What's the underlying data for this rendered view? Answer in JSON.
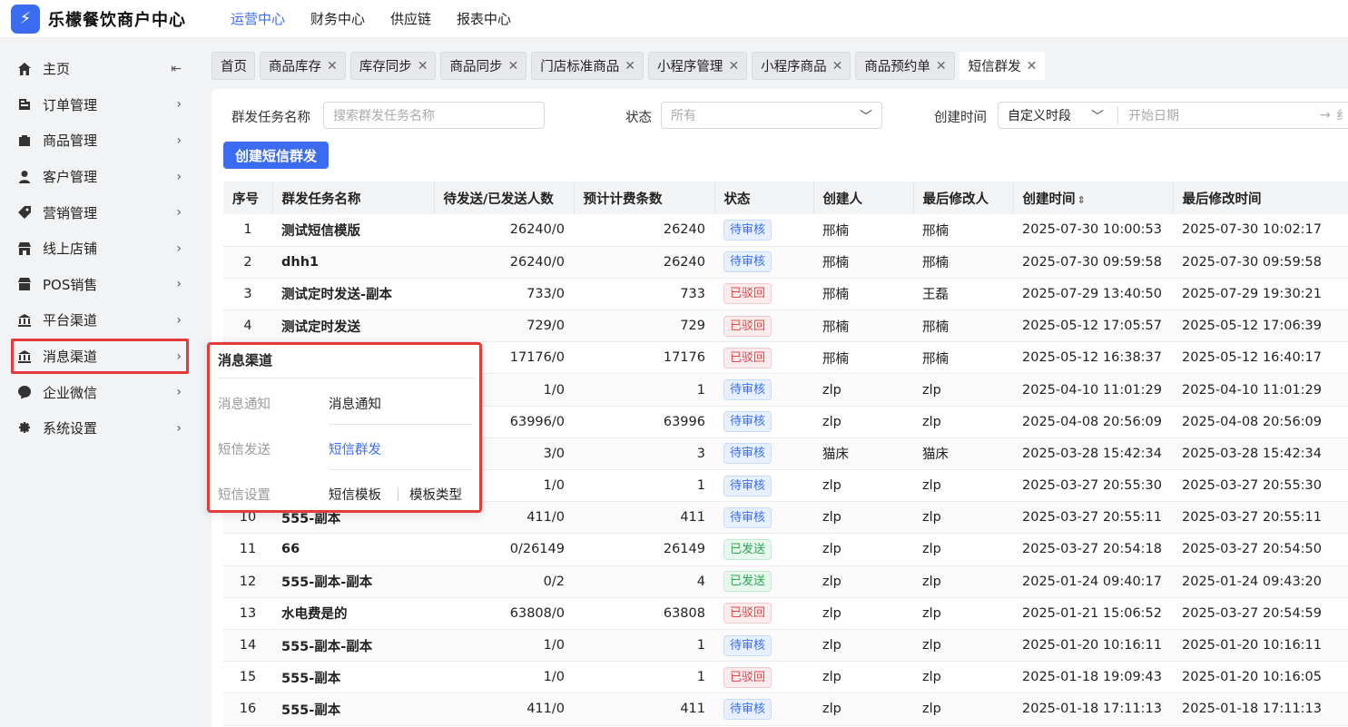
{
  "app": {
    "title": "乐檬餐饮商户中心",
    "logo_glyph": "⚡"
  },
  "top_nav": [
    {
      "label": "运营中心",
      "active": true
    },
    {
      "label": "财务中心",
      "active": false
    },
    {
      "label": "供应链",
      "active": false
    },
    {
      "label": "报表中心",
      "active": false
    }
  ],
  "sidebar": {
    "collapse_glyph": "⇤",
    "arrow_glyph": "›",
    "items": [
      {
        "label": "主页",
        "icon": "home-icon"
      },
      {
        "label": "订单管理",
        "icon": "order-icon"
      },
      {
        "label": "商品管理",
        "icon": "goods-icon"
      },
      {
        "label": "客户管理",
        "icon": "user-icon"
      },
      {
        "label": "营销管理",
        "icon": "tag-icon"
      },
      {
        "label": "线上店铺",
        "icon": "store-icon"
      },
      {
        "label": "POS销售",
        "icon": "pos-icon"
      },
      {
        "label": "平台渠道",
        "icon": "platform-icon"
      },
      {
        "label": "消息渠道",
        "icon": "message-icon"
      },
      {
        "label": "企业微信",
        "icon": "wechat-icon"
      },
      {
        "label": "系统设置",
        "icon": "gear-icon"
      }
    ]
  },
  "tabs": [
    {
      "label": "首页",
      "closable": false
    },
    {
      "label": "商品库存",
      "closable": true
    },
    {
      "label": "库存同步",
      "closable": true
    },
    {
      "label": "商品同步",
      "closable": true
    },
    {
      "label": "门店标准商品",
      "closable": true
    },
    {
      "label": "小程序管理",
      "closable": true
    },
    {
      "label": "小程序商品",
      "closable": true
    },
    {
      "label": "商品预约单",
      "closable": true
    },
    {
      "label": "短信群发",
      "closable": true,
      "active": true
    }
  ],
  "tab_close_glyph": "✕",
  "filters": {
    "task_name_label": "群发任务名称",
    "task_name_placeholder": "搜索群发任务名称",
    "status_label": "状态",
    "status_value": "所有",
    "created_label": "创建时间",
    "created_range_value": "自定义时段",
    "start_date_placeholder": "开始日期",
    "range_sep": "→",
    "end_partial": "纟"
  },
  "create_button": "创建短信群发",
  "table": {
    "headers": [
      "序号",
      "群发任务名称",
      "待发送/已发送人数",
      "预计计费条数",
      "状态",
      "创建人",
      "最后修改人",
      "创建时间",
      "最后修改时间"
    ],
    "sort_glyph": "⇕",
    "rows": [
      [
        "1",
        "测试短信模版",
        "26240/0",
        "26240",
        "待审核",
        "邢楠",
        "邢楠",
        "2025-07-30 10:00:53",
        "2025-07-30 10:02:17"
      ],
      [
        "2",
        "dhh1",
        "26240/0",
        "26240",
        "待审核",
        "邢楠",
        "邢楠",
        "2025-07-30 09:59:58",
        "2025-07-30 09:59:58"
      ],
      [
        "3",
        "测试定时发送-副本",
        "733/0",
        "733",
        "已驳回",
        "邢楠",
        "王磊",
        "2025-07-29 13:40:50",
        "2025-07-29 19:30:21"
      ],
      [
        "4",
        "测试定时发送",
        "729/0",
        "729",
        "已驳回",
        "邢楠",
        "邢楠",
        "2025-05-12 17:05:57",
        "2025-05-12 17:06:39"
      ],
      [
        "",
        "",
        "17176/0",
        "17176",
        "已驳回",
        "邢楠",
        "邢楠",
        "2025-05-12 16:38:37",
        "2025-05-12 16:40:17"
      ],
      [
        "",
        "",
        "1/0",
        "1",
        "待审核",
        "zlp",
        "zlp",
        "2025-04-10 11:01:29",
        "2025-04-10 11:01:29"
      ],
      [
        "",
        "",
        "63996/0",
        "63996",
        "待审核",
        "zlp",
        "zlp",
        "2025-04-08 20:56:09",
        "2025-04-08 20:56:09"
      ],
      [
        "",
        "",
        "3/0",
        "3",
        "待审核",
        "猫床",
        "猫床",
        "2025-03-28 15:42:34",
        "2025-03-28 15:42:34"
      ],
      [
        "",
        "",
        "1/0",
        "1",
        "待审核",
        "zlp",
        "zlp",
        "2025-03-27 20:55:30",
        "2025-03-27 20:55:30"
      ],
      [
        "10",
        "555-副本",
        "411/0",
        "411",
        "待审核",
        "zlp",
        "zlp",
        "2025-03-27 20:55:11",
        "2025-03-27 20:55:11"
      ],
      [
        "11",
        "66",
        "0/26149",
        "26149",
        "已发送",
        "zlp",
        "zlp",
        "2025-03-27 20:54:18",
        "2025-03-27 20:54:50"
      ],
      [
        "12",
        "555-副本-副本",
        "0/2",
        "4",
        "已发送",
        "zlp",
        "zlp",
        "2025-01-24 09:40:17",
        "2025-01-24 09:43:20"
      ],
      [
        "13",
        "水电费是的",
        "63808/0",
        "63808",
        "已驳回",
        "zlp",
        "zlp",
        "2025-01-21 15:06:52",
        "2025-03-27 20:54:59"
      ],
      [
        "14",
        "555-副本-副本",
        "1/0",
        "1",
        "待审核",
        "zlp",
        "zlp",
        "2025-01-20 10:16:11",
        "2025-01-20 10:16:11"
      ],
      [
        "15",
        "555-副本",
        "1/0",
        "1",
        "已驳回",
        "zlp",
        "zlp",
        "2025-01-18 19:09:43",
        "2025-01-20 10:16:05"
      ],
      [
        "16",
        "555-副本",
        "411/0",
        "411",
        "待审核",
        "zlp",
        "zlp",
        "2025-01-18 17:11:13",
        "2025-01-18 17:11:13"
      ]
    ]
  },
  "status_colors": {
    "待审核": "#3b6cf0",
    "已驳回": "#e04848",
    "已发送": "#2ca855"
  },
  "flyout": {
    "title": "消息渠道",
    "rows": [
      {
        "category": "消息通知",
        "links": [
          {
            "label": "消息通知",
            "active": false
          }
        ]
      },
      {
        "category": "短信发送",
        "links": [
          {
            "label": "短信群发",
            "active": true
          }
        ]
      },
      {
        "category": "短信设置",
        "links": [
          {
            "label": "短信模板",
            "active": false
          },
          {
            "label": "模板类型",
            "active": false
          }
        ]
      }
    ]
  }
}
